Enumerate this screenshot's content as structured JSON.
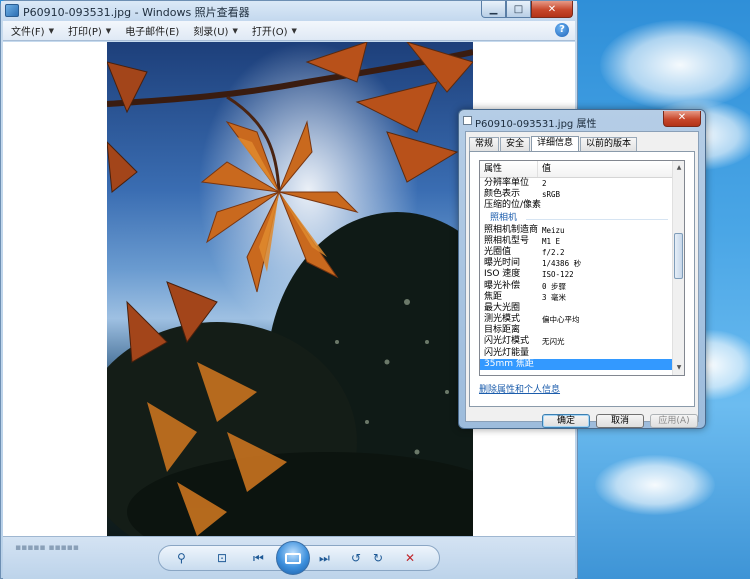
{
  "viewer": {
    "title": "P60910-093531.jpg - Windows 照片查看器",
    "window_buttons": {
      "minimize": "▁",
      "maximize": "□",
      "close": "✕"
    },
    "menu": [
      {
        "label": "文件(F)"
      },
      {
        "label": "打印(P)"
      },
      {
        "label": "电子邮件(E)"
      },
      {
        "label": "刻录(U)"
      },
      {
        "label": "打开(O)"
      }
    ],
    "help": "?",
    "controls": {
      "zoom": "⚲",
      "fit": "⊡",
      "prev": "⏮",
      "next": "⏭",
      "rotate_left": "↺",
      "rotate_right": "↻",
      "delete": "✕"
    }
  },
  "dialog": {
    "title": "P60910-093531.jpg 属性",
    "close": "✕",
    "tabs": [
      "常规",
      "安全",
      "详细信息",
      "以前的版本"
    ],
    "active_tab": 2,
    "list": {
      "header": {
        "property": "属性",
        "value": "值"
      },
      "rows": [
        {
          "k": "分辨率单位",
          "v": "2"
        },
        {
          "k": "颜色表示",
          "v": "sRGB"
        },
        {
          "k": "压缩的位/像素",
          "v": ""
        },
        {
          "section": "照相机"
        },
        {
          "k": "照相机制造商",
          "v": "Meizu"
        },
        {
          "k": "照相机型号",
          "v": "M1 E"
        },
        {
          "k": "光圈值",
          "v": "f/2.2"
        },
        {
          "k": "曝光时间",
          "v": "1/4386 秒"
        },
        {
          "k": "ISO 速度",
          "v": "ISO-122"
        },
        {
          "k": "曝光补偿",
          "v": "0 步骤"
        },
        {
          "k": "焦距",
          "v": "3 毫米"
        },
        {
          "k": "最大光圈",
          "v": ""
        },
        {
          "k": "测光模式",
          "v": "偏中心平均"
        },
        {
          "k": "目标距离",
          "v": ""
        },
        {
          "k": "闪光灯模式",
          "v": "无闪光"
        },
        {
          "k": "闪光灯能量",
          "v": ""
        },
        {
          "k": "35mm 焦距",
          "v": "",
          "selected": true
        }
      ]
    },
    "remove_link": "删除属性和个人信息",
    "buttons": {
      "ok": "确定",
      "cancel": "取消",
      "apply": "应用(A)"
    }
  },
  "colors": {
    "selection": "#3399ff",
    "link": "#1c5dac",
    "close_red": "#c7472b"
  }
}
